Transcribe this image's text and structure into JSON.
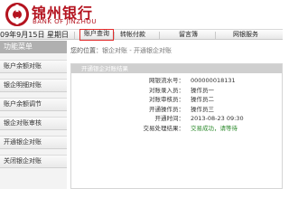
{
  "header": {
    "bank_name_cn": "锦州银行",
    "bank_name_en": "BANK OF JINZHOU",
    "brand_color": "#b4131f"
  },
  "navbar": {
    "date": "09年9月15日 星期日",
    "items": [
      {
        "label": "账户查询",
        "active": true
      },
      {
        "label": "转帐付款",
        "active": false
      },
      {
        "label": "留言簿",
        "active": false
      },
      {
        "label": "网银服务",
        "active": false
      }
    ]
  },
  "sidebar": {
    "title": "功能菜单",
    "items": [
      {
        "label": "账户余额对账"
      },
      {
        "label": "银企明细对账"
      },
      {
        "label": "账户余额调节"
      },
      {
        "label": "银企对账审核"
      },
      {
        "label": "开通银企对账"
      },
      {
        "label": "关闭银企对账"
      }
    ]
  },
  "breadcrumb": {
    "prefix": "您的位置：",
    "path": "银企对账 - 开通银企对账"
  },
  "panel": {
    "title": "开通银企对账结果",
    "rows": [
      {
        "label": "网银流水号：",
        "value": "000000018131"
      },
      {
        "label": "对账录入员：",
        "value": "操作员一"
      },
      {
        "label": "对账审核员：",
        "value": "操作员二"
      },
      {
        "label": "开通操作员：",
        "value": "操作员三"
      },
      {
        "label": "开通时间：",
        "value": "2013-08-23 09:30"
      },
      {
        "label": "交易处理结果：",
        "value": "交易成功，请等待"
      }
    ]
  },
  "colors": {
    "active_nav_border": "#e32b2b",
    "success_text": "#2e8b2e"
  }
}
